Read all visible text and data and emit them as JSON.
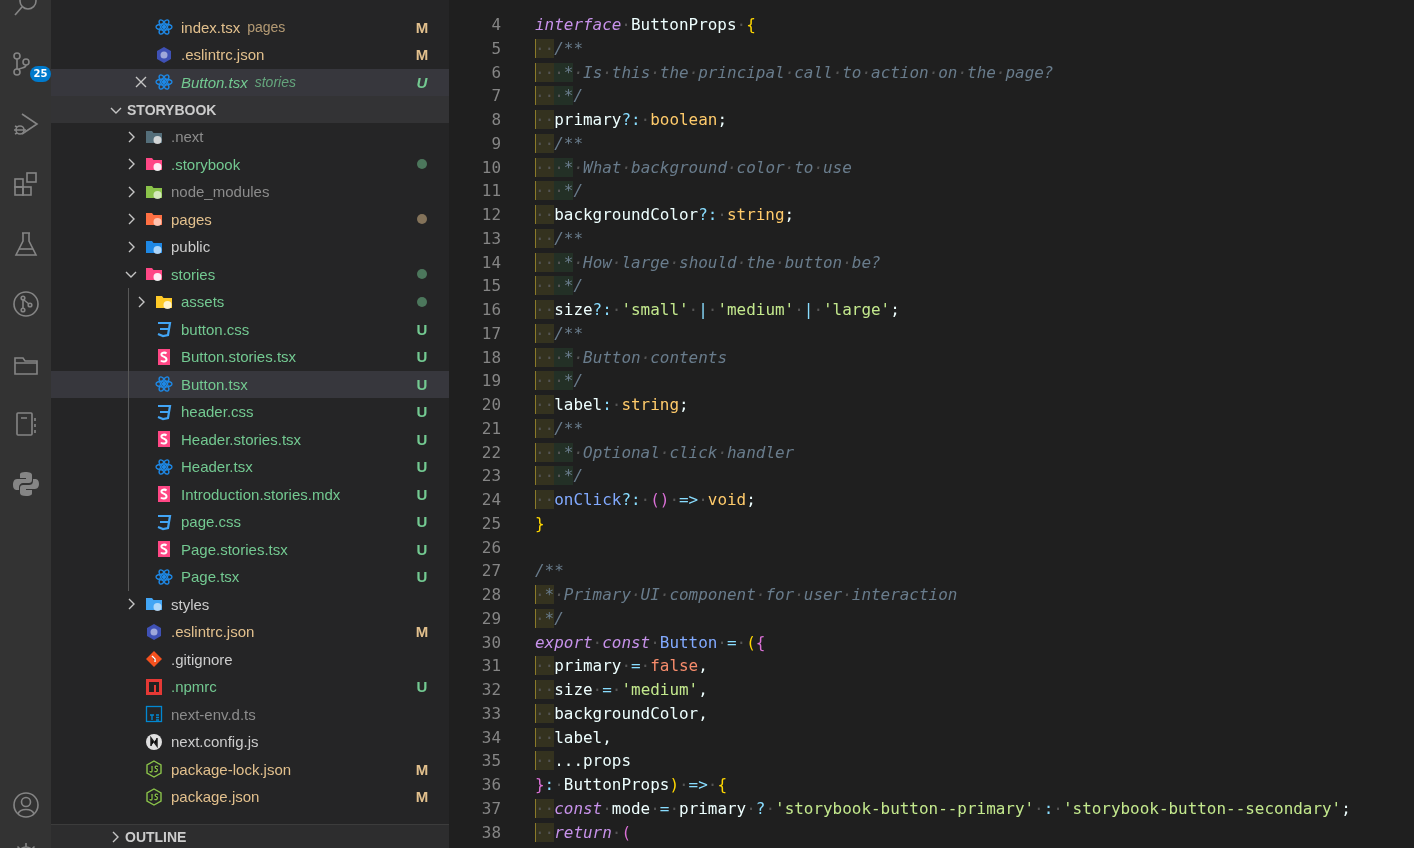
{
  "activity_bar": {
    "source_control_badge": "25"
  },
  "open_editors": [
    {
      "name": "index.tsx",
      "description": "pages",
      "kind": "react",
      "color": "#e2c08d",
      "badge": "M",
      "active": false,
      "preview": false
    },
    {
      "name": ".eslintrc.json",
      "kind": "eslint",
      "color": "#e2c08d",
      "badge": "M",
      "active": false,
      "preview": false
    },
    {
      "name": "Button.tsx",
      "description": "stories",
      "kind": "react",
      "color": "#73c991",
      "badge": "U",
      "active": true,
      "preview": true
    }
  ],
  "explorer": {
    "title": "STORYBOOK",
    "expanded": true,
    "items": [
      {
        "name": ".next",
        "kind": "folder-next",
        "color": "#8c8c8c",
        "expanded": false,
        "dot": false,
        "selected": false
      },
      {
        "name": ".storybook",
        "kind": "folder-storybook",
        "color": "#73c991",
        "expanded": false,
        "dot": true,
        "selected": false
      },
      {
        "name": "node_modules",
        "kind": "folder-node",
        "color": "#8c8c8c",
        "expanded": false,
        "dot": false,
        "selected": false
      },
      {
        "name": "pages",
        "kind": "folder-pages",
        "color": "#e2c08d",
        "expanded": false,
        "dot": true,
        "selected": false
      },
      {
        "name": "public",
        "kind": "folder-public",
        "color": "#cccccc",
        "expanded": false,
        "dot": false,
        "selected": false
      },
      {
        "name": "stories",
        "kind": "folder-stories",
        "color": "#73c991",
        "expanded": true,
        "dot": true,
        "selected": false,
        "children": [
          {
            "name": "assets",
            "kind": "folder-assets",
            "color": "#73c991",
            "expanded": false,
            "dot": true,
            "selected": false
          },
          {
            "name": "button.css",
            "kind": "css",
            "color": "#73c991",
            "badge": "U",
            "selected": false
          },
          {
            "name": "Button.stories.tsx",
            "kind": "storybook",
            "color": "#73c991",
            "badge": "U",
            "selected": false
          },
          {
            "name": "Button.tsx",
            "kind": "react",
            "color": "#73c991",
            "badge": "U",
            "selected": true
          },
          {
            "name": "header.css",
            "kind": "css",
            "color": "#73c991",
            "badge": "U",
            "selected": false
          },
          {
            "name": "Header.stories.tsx",
            "kind": "storybook",
            "color": "#73c991",
            "badge": "U",
            "selected": false
          },
          {
            "name": "Header.tsx",
            "kind": "react",
            "color": "#73c991",
            "badge": "U",
            "selected": false
          },
          {
            "name": "Introduction.stories.mdx",
            "kind": "storybook",
            "color": "#73c991",
            "badge": "U",
            "selected": false
          },
          {
            "name": "page.css",
            "kind": "css",
            "color": "#73c991",
            "badge": "U",
            "selected": false
          },
          {
            "name": "Page.stories.tsx",
            "kind": "storybook",
            "color": "#73c991",
            "badge": "U",
            "selected": false
          },
          {
            "name": "Page.tsx",
            "kind": "react",
            "color": "#73c991",
            "badge": "U",
            "selected": false
          }
        ]
      },
      {
        "name": "styles",
        "kind": "folder-styles",
        "color": "#cccccc",
        "expanded": false,
        "dot": false,
        "selected": false
      },
      {
        "name": ".eslintrc.json",
        "kind": "eslint",
        "color": "#e2c08d",
        "badge": "M",
        "selected": false
      },
      {
        "name": ".gitignore",
        "kind": "git",
        "color": "#cccccc",
        "selected": false
      },
      {
        "name": ".npmrc",
        "kind": "npm",
        "color": "#73c991",
        "badge": "U",
        "selected": false
      },
      {
        "name": "next-env.d.ts",
        "kind": "ts",
        "color": "#8c8c8c",
        "selected": false
      },
      {
        "name": "next.config.js",
        "kind": "next",
        "color": "#cccccc",
        "selected": false
      },
      {
        "name": "package-lock.json",
        "kind": "nodejs",
        "color": "#e2c08d",
        "badge": "M",
        "selected": false
      },
      {
        "name": "package.json",
        "kind": "nodejs",
        "color": "#e2c08d",
        "badge": "M",
        "selected": false
      }
    ]
  },
  "outline": {
    "title": "OUTLINE",
    "expanded": false
  },
  "editor": {
    "lines": [
      {
        "number": "4",
        "tokens": [
          {
            "kind": "kw",
            "text": "interface"
          },
          {
            "kind": "id",
            "text": "·ButtonProps·"
          },
          {
            "kind": "br1",
            "text": "{"
          }
        ]
      },
      {
        "number": "5",
        "indent": [
          "··"
        ],
        "tokens": [
          {
            "kind": "cm",
            "text": "/**"
          }
        ]
      },
      {
        "number": "6",
        "indent": [
          "··",
          "·*"
        ],
        "tokens": [
          {
            "kind": "cm",
            "text": "·Is·this·the·principal·call·to·action·on·the·page?"
          }
        ]
      },
      {
        "number": "7",
        "indent": [
          "··",
          "·*"
        ],
        "tokens": [
          {
            "kind": "cm",
            "text": "/"
          }
        ]
      },
      {
        "number": "8",
        "indent": [
          "··"
        ],
        "tokens": [
          {
            "kind": "id",
            "text": "primary"
          },
          {
            "kind": "op",
            "text": "?:"
          },
          {
            "kind": "id",
            "text": "·"
          },
          {
            "kind": "ty",
            "text": "boolean"
          },
          {
            "kind": "id",
            "text": ";"
          }
        ]
      },
      {
        "number": "9",
        "indent": [
          "··"
        ],
        "tokens": [
          {
            "kind": "cm",
            "text": "/**"
          }
        ]
      },
      {
        "number": "10",
        "indent": [
          "··",
          "·*"
        ],
        "tokens": [
          {
            "kind": "cm",
            "text": "·What·background·color·to·use"
          }
        ]
      },
      {
        "number": "11",
        "indent": [
          "··",
          "·*"
        ],
        "tokens": [
          {
            "kind": "cm",
            "text": "/"
          }
        ]
      },
      {
        "number": "12",
        "indent": [
          "··"
        ],
        "tokens": [
          {
            "kind": "id",
            "text": "backgroundColor"
          },
          {
            "kind": "op",
            "text": "?:"
          },
          {
            "kind": "id",
            "text": "·"
          },
          {
            "kind": "ty",
            "text": "string"
          },
          {
            "kind": "id",
            "text": ";"
          }
        ]
      },
      {
        "number": "13",
        "indent": [
          "··"
        ],
        "tokens": [
          {
            "kind": "cm",
            "text": "/**"
          }
        ]
      },
      {
        "number": "14",
        "indent": [
          "··",
          "·*"
        ],
        "tokens": [
          {
            "kind": "cm",
            "text": "·How·large·should·the·button·be?"
          }
        ]
      },
      {
        "number": "15",
        "indent": [
          "··",
          "·*"
        ],
        "tokens": [
          {
            "kind": "cm",
            "text": "/"
          }
        ]
      },
      {
        "number": "16",
        "indent": [
          "··"
        ],
        "tokens": [
          {
            "kind": "id",
            "text": "size"
          },
          {
            "kind": "op",
            "text": "?:"
          },
          {
            "kind": "id",
            "text": "·"
          },
          {
            "kind": "str",
            "text": "'small'"
          },
          {
            "kind": "id",
            "text": "·"
          },
          {
            "kind": "op",
            "text": "|"
          },
          {
            "kind": "id",
            "text": "·"
          },
          {
            "kind": "str",
            "text": "'medium'"
          },
          {
            "kind": "id",
            "text": "·"
          },
          {
            "kind": "op",
            "text": "|"
          },
          {
            "kind": "id",
            "text": "·"
          },
          {
            "kind": "str",
            "text": "'large'"
          },
          {
            "kind": "id",
            "text": ";"
          }
        ]
      },
      {
        "number": "17",
        "indent": [
          "··"
        ],
        "tokens": [
          {
            "kind": "cm",
            "text": "/**"
          }
        ]
      },
      {
        "number": "18",
        "indent": [
          "··",
          "·*"
        ],
        "tokens": [
          {
            "kind": "cm",
            "text": "·Button·contents"
          }
        ]
      },
      {
        "number": "19",
        "indent": [
          "··",
          "·*"
        ],
        "tokens": [
          {
            "kind": "cm",
            "text": "/"
          }
        ]
      },
      {
        "number": "20",
        "indent": [
          "··"
        ],
        "tokens": [
          {
            "kind": "id",
            "text": "label"
          },
          {
            "kind": "op",
            "text": ":"
          },
          {
            "kind": "id",
            "text": "·"
          },
          {
            "kind": "ty",
            "text": "string"
          },
          {
            "kind": "id",
            "text": ";"
          }
        ]
      },
      {
        "number": "21",
        "indent": [
          "··"
        ],
        "tokens": [
          {
            "kind": "cm",
            "text": "/**"
          }
        ]
      },
      {
        "number": "22",
        "indent": [
          "··",
          "·*"
        ],
        "tokens": [
          {
            "kind": "cm",
            "text": "·Optional·click·handler"
          }
        ]
      },
      {
        "number": "23",
        "indent": [
          "··",
          "·*"
        ],
        "tokens": [
          {
            "kind": "cm",
            "text": "/"
          }
        ]
      },
      {
        "number": "24",
        "indent": [
          "··"
        ],
        "tokens": [
          {
            "kind": "fn",
            "text": "onClick"
          },
          {
            "kind": "op",
            "text": "?:"
          },
          {
            "kind": "id",
            "text": "·"
          },
          {
            "kind": "br2",
            "text": "()"
          },
          {
            "kind": "id",
            "text": "·"
          },
          {
            "kind": "op",
            "text": "=>"
          },
          {
            "kind": "id",
            "text": "·"
          },
          {
            "kind": "ty",
            "text": "void"
          },
          {
            "kind": "id",
            "text": ";"
          }
        ]
      },
      {
        "number": "25",
        "tokens": [
          {
            "kind": "br1",
            "text": "}"
          }
        ]
      },
      {
        "number": "26"
      },
      {
        "number": "27",
        "tokens": [
          {
            "kind": "cm",
            "text": "/**"
          }
        ]
      },
      {
        "number": "28",
        "indent": [
          "·*"
        ],
        "tokens": [
          {
            "kind": "cm",
            "text": "·Primary·UI·component·for·user·interaction"
          }
        ]
      },
      {
        "number": "29",
        "indent": [
          "·*"
        ],
        "tokens": [
          {
            "kind": "cm",
            "text": "/"
          }
        ]
      },
      {
        "number": "30",
        "tokens": [
          {
            "kind": "kw",
            "text": "export"
          },
          {
            "kind": "id",
            "text": "·"
          },
          {
            "kind": "kw",
            "text": "const"
          },
          {
            "kind": "id",
            "text": "·"
          },
          {
            "kind": "fn",
            "text": "Button"
          },
          {
            "kind": "id",
            "text": "·"
          },
          {
            "kind": "op",
            "text": "="
          },
          {
            "kind": "id",
            "text": "·"
          },
          {
            "kind": "br1",
            "text": "("
          },
          {
            "kind": "br2",
            "text": "{"
          }
        ]
      },
      {
        "number": "31",
        "indent": [
          "··"
        ],
        "tokens": [
          {
            "kind": "id",
            "text": "primary"
          },
          {
            "kind": "id",
            "text": "·"
          },
          {
            "kind": "op",
            "text": "="
          },
          {
            "kind": "id",
            "text": "·"
          },
          {
            "kind": "bool",
            "text": "false"
          },
          {
            "kind": "id",
            "text": ","
          }
        ]
      },
      {
        "number": "32",
        "indent": [
          "··"
        ],
        "tokens": [
          {
            "kind": "id",
            "text": "size"
          },
          {
            "kind": "id",
            "text": "·"
          },
          {
            "kind": "op",
            "text": "="
          },
          {
            "kind": "id",
            "text": "·"
          },
          {
            "kind": "str",
            "text": "'medium'"
          },
          {
            "kind": "id",
            "text": ","
          }
        ]
      },
      {
        "number": "33",
        "indent": [
          "··"
        ],
        "tokens": [
          {
            "kind": "id",
            "text": "backgroundColor,"
          }
        ]
      },
      {
        "number": "34",
        "indent": [
          "··"
        ],
        "tokens": [
          {
            "kind": "id",
            "text": "label,"
          }
        ]
      },
      {
        "number": "35",
        "indent": [
          "··"
        ],
        "tokens": [
          {
            "kind": "id",
            "text": "...props"
          }
        ]
      },
      {
        "number": "36",
        "tokens": [
          {
            "kind": "br2",
            "text": "}"
          },
          {
            "kind": "op",
            "text": ":"
          },
          {
            "kind": "id",
            "text": "·ButtonProps"
          },
          {
            "kind": "br1",
            "text": ")"
          },
          {
            "kind": "id",
            "text": "·"
          },
          {
            "kind": "op",
            "text": "=>"
          },
          {
            "kind": "id",
            "text": "·"
          },
          {
            "kind": "br1",
            "text": "{"
          }
        ]
      },
      {
        "number": "37",
        "indent": [
          "··"
        ],
        "tokens": [
          {
            "kind": "kw",
            "text": "const"
          },
          {
            "kind": "id",
            "text": "·mode·"
          },
          {
            "kind": "op",
            "text": "="
          },
          {
            "kind": "id",
            "text": "·primary·"
          },
          {
            "kind": "op",
            "text": "?"
          },
          {
            "kind": "id",
            "text": "·"
          },
          {
            "kind": "str",
            "text": "'storybook-button--primary'"
          },
          {
            "kind": "id",
            "text": "·"
          },
          {
            "kind": "op",
            "text": ":"
          },
          {
            "kind": "id",
            "text": "·"
          },
          {
            "kind": "str",
            "text": "'storybook-button--secondary'"
          },
          {
            "kind": "id",
            "text": ";"
          }
        ]
      },
      {
        "number": "38",
        "indent": [
          "··"
        ],
        "tokens": [
          {
            "kind": "kw",
            "text": "return"
          },
          {
            "kind": "id",
            "text": "·"
          },
          {
            "kind": "br2",
            "text": "("
          }
        ]
      }
    ]
  }
}
